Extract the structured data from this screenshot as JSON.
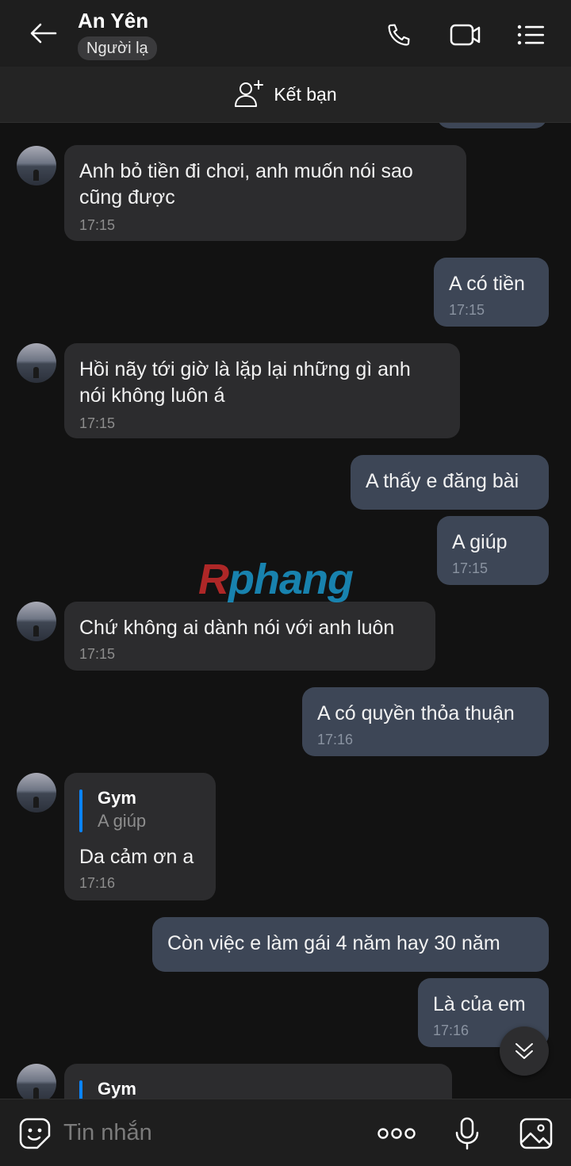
{
  "header": {
    "contact_name": "An Yên",
    "contact_status": "Người lạ"
  },
  "friend_bar": {
    "label": "Kết bạn"
  },
  "messages": [
    {
      "direction": "sent",
      "text": "",
      "partial": true
    },
    {
      "direction": "received",
      "text": "Anh bỏ tiền đi chơi, anh muốn nói sao\ncũng được",
      "time": "17:15"
    },
    {
      "direction": "sent",
      "text": "A có tiền",
      "time": "17:15"
    },
    {
      "direction": "received",
      "text": "Hồi nãy tới giờ là lặp lại những gì anh\nnói không luôn á",
      "time": "17:15"
    },
    {
      "direction": "sent",
      "text": "A thấy e đăng bài"
    },
    {
      "direction": "sent",
      "text": "A giúp",
      "time": "17:15"
    },
    {
      "direction": "received",
      "text": "Chứ không ai dành nói với anh luôn",
      "time": "17:15"
    },
    {
      "direction": "sent",
      "text": "A có quyền thỏa thuận",
      "time": "17:16"
    },
    {
      "direction": "received",
      "quote": {
        "author": "Gym",
        "text": "A giúp"
      },
      "text": "Da cảm ơn a",
      "time": "17:16"
    },
    {
      "direction": "sent",
      "text": "Còn việc e làm gái 4 năm hay 30 năm"
    },
    {
      "direction": "sent",
      "text": "Là của em",
      "time": "17:16"
    },
    {
      "direction": "received",
      "quote": {
        "author": "Gym"
      },
      "partial": true
    }
  ],
  "watermark": {
    "text_r": "R",
    "text_rest": "phang"
  },
  "composer": {
    "placeholder": "Tin nhắn"
  },
  "icons": {
    "back": "arrow-left-icon",
    "call": "phone-icon",
    "video": "video-camera-icon",
    "menu": "list-menu-icon",
    "add_friend": "add-user-icon",
    "scroll_down": "double-chevron-down-icon",
    "sticker": "sticker-emoji-icon",
    "more": "more-dots-icon",
    "mic": "microphone-icon",
    "gallery": "image-gallery-icon"
  },
  "colors": {
    "background": "#121212",
    "header": "#1e1e1e",
    "received_bubble": "#2c2c2e",
    "sent_bubble": "#3d4656",
    "quote_bar": "#0a84ff"
  }
}
